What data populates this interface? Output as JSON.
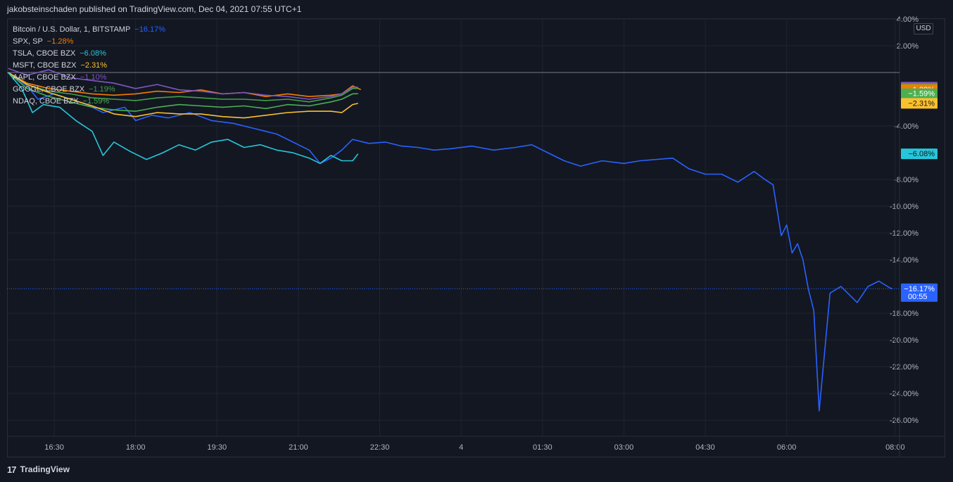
{
  "header": {
    "published_text": "jakobsteinschaden published on TradingView.com, Dec 04, 2021 07:55 UTC+1"
  },
  "footer": {
    "brand": "TradingView",
    "logo_icon": "tradingview-logo-icon"
  },
  "price_axis": {
    "currency": "USD"
  },
  "colors": {
    "background": "#131722",
    "grid": "#1f2431",
    "btc": "#2962ff",
    "spx": "#f57c00",
    "tsla": "#26c6da",
    "msft": "#fbc02d",
    "aapl": "#7e57c2",
    "googl": "#43a047",
    "ndaq": "#4caf50"
  },
  "chart_data": {
    "type": "line",
    "title": "Bitcoin / U.S. Dollar, 1, BITSTAMP",
    "y_unit": "%",
    "ylim": [
      -27.2,
      4.0
    ],
    "y_ticks": [
      "4.00%",
      "2.00%",
      "-4.00%",
      "-8.00%",
      "-10.00%",
      "-12.00%",
      "-14.00%",
      "-18.00%",
      "-20.00%",
      "-22.00%",
      "-24.00%",
      "-26.00%"
    ],
    "y_tick_values": [
      4,
      2,
      -4,
      -8,
      -10,
      -12,
      -14,
      -18,
      -20,
      -22,
      -24,
      -26
    ],
    "x_labels": [
      "16:30",
      "18:00",
      "19:30",
      "21:00",
      "22:30",
      "4",
      "01:30",
      "03:00",
      "04:30",
      "06:00",
      "08:00"
    ],
    "x_label_hours": [
      16.5,
      18,
      19.5,
      21,
      22.5,
      24,
      25.5,
      27,
      28.5,
      30,
      32
    ],
    "xlim_hours": [
      15.63,
      32.08
    ],
    "zero_line": 0,
    "legend": [
      {
        "key": "btc",
        "name": "Bitcoin / U.S. Dollar, 1, BITSTAMP",
        "value": "−16.17%"
      },
      {
        "key": "spx",
        "name": "SPX, SP",
        "value": "−1.28%"
      },
      {
        "key": "tsla",
        "name": "TSLA, CBOE BZX",
        "value": "−6.08%"
      },
      {
        "key": "msft",
        "name": "MSFT, CBOE BZX",
        "value": "−2.31%"
      },
      {
        "key": "aapl",
        "name": "AAPL, CBOE BZX",
        "value": "−1.10%"
      },
      {
        "key": "googl",
        "name": "GOOGL, CBOE BZX",
        "value": "−1.19%"
      },
      {
        "key": "ndaq",
        "name": "NDAQ, CBOE BZX",
        "value": "−1.59%"
      }
    ],
    "badges": [
      {
        "key": "aapl",
        "label": "−1.10%",
        "value": -1.1
      },
      {
        "key": "googl",
        "label": "−1.19%",
        "value": -1.19
      },
      {
        "key": "spx",
        "label": "−1.28%",
        "value": -1.28
      },
      {
        "key": "ndaq",
        "label": "−1.59%",
        "value": -1.59
      },
      {
        "key": "msft",
        "label": "−2.31%",
        "value": -2.31
      },
      {
        "key": "tsla",
        "label": "−6.08%",
        "value": -6.08
      },
      {
        "key": "btc",
        "label": "−16.17%",
        "value": -16.17,
        "countdown": "00:55"
      }
    ],
    "series": [
      {
        "key": "btc",
        "name": "Bitcoin / U.S. Dollar, 1, BITSTAMP",
        "x": [
          15.65,
          15.8,
          16.0,
          16.2,
          16.5,
          16.8,
          17.1,
          17.4,
          17.8,
          18.0,
          18.3,
          18.6,
          19.0,
          19.4,
          19.8,
          20.2,
          20.6,
          21.0,
          21.2,
          21.4,
          21.6,
          21.8,
          22.0,
          22.3,
          22.6,
          22.9,
          23.2,
          23.5,
          23.8,
          24.2,
          24.6,
          25.0,
          25.3,
          25.6,
          25.9,
          26.2,
          26.6,
          27.0,
          27.3,
          27.6,
          27.9,
          28.2,
          28.5,
          28.8,
          29.1,
          29.4,
          29.6,
          29.75,
          29.9,
          30.0,
          30.1,
          30.2,
          30.3,
          30.4,
          30.45,
          30.5,
          30.6,
          30.8,
          31.0,
          31.3,
          31.5,
          31.7,
          31.9,
          31.95
        ],
        "values": [
          0.0,
          -0.5,
          -1.0,
          -2.0,
          -1.6,
          -2.0,
          -2.4,
          -3.0,
          -2.6,
          -3.6,
          -3.2,
          -3.4,
          -3.0,
          -3.6,
          -3.8,
          -4.2,
          -4.6,
          -5.4,
          -5.8,
          -6.8,
          -6.4,
          -5.8,
          -5.0,
          -5.3,
          -5.2,
          -5.5,
          -5.6,
          -5.8,
          -5.7,
          -5.5,
          -5.8,
          -5.6,
          -5.4,
          -6.0,
          -6.6,
          -7.0,
          -6.6,
          -6.8,
          -6.6,
          -6.5,
          -6.4,
          -7.2,
          -7.6,
          -7.6,
          -8.2,
          -7.4,
          -8.0,
          -8.4,
          -12.2,
          -11.4,
          -13.5,
          -12.8,
          -14.0,
          -16.2,
          -17.0,
          -17.8,
          -25.3,
          -16.5,
          -16.0,
          -17.2,
          -16.0,
          -15.6,
          -16.1,
          -16.17
        ]
      },
      {
        "key": "spx",
        "name": "SPX, SP",
        "x": [
          15.65,
          16.0,
          16.4,
          16.8,
          17.2,
          17.6,
          18.0,
          18.4,
          18.8,
          19.2,
          19.6,
          20.0,
          20.4,
          20.8,
          21.2,
          21.6,
          21.8,
          22.0,
          22.15
        ],
        "values": [
          0.0,
          -0.8,
          -1.2,
          -1.4,
          -1.6,
          -1.7,
          -1.6,
          -1.4,
          -1.5,
          -1.3,
          -1.6,
          -1.5,
          -1.8,
          -1.6,
          -1.8,
          -1.7,
          -1.6,
          -1.0,
          -1.28
        ]
      },
      {
        "key": "aapl",
        "name": "AAPL, CBOE BZX",
        "x": [
          15.65,
          16.0,
          16.4,
          16.8,
          17.2,
          17.6,
          18.0,
          18.4,
          18.8,
          19.2,
          19.6,
          20.0,
          20.4,
          20.8,
          21.2,
          21.6,
          21.8,
          22.0,
          22.1
        ],
        "values": [
          0.3,
          -0.2,
          0.2,
          -0.4,
          -0.6,
          -0.8,
          -1.2,
          -0.9,
          -1.3,
          -1.4,
          -1.6,
          -1.5,
          -1.7,
          -1.8,
          -2.0,
          -1.8,
          -1.6,
          -1.1,
          -1.1
        ]
      },
      {
        "key": "googl",
        "name": "GOOGL, CBOE BZX",
        "x": [
          15.65,
          16.0,
          16.4,
          16.8,
          17.2,
          17.6,
          18.0,
          18.4,
          18.8,
          19.2,
          19.6,
          20.0,
          20.4,
          20.8,
          21.2,
          21.6,
          21.8,
          22.0,
          22.1
        ],
        "values": [
          0.0,
          -0.9,
          -1.4,
          -1.6,
          -1.9,
          -2.0,
          -2.1,
          -1.9,
          -1.8,
          -1.9,
          -2.0,
          -2.0,
          -2.1,
          -2.0,
          -2.2,
          -1.9,
          -1.7,
          -1.2,
          -1.19
        ]
      },
      {
        "key": "ndaq",
        "name": "NDAQ, CBOE BZX",
        "x": [
          15.65,
          16.0,
          16.4,
          16.8,
          17.2,
          17.6,
          18.0,
          18.4,
          18.8,
          19.2,
          19.6,
          20.0,
          20.4,
          20.8,
          21.2,
          21.6,
          21.8,
          22.0,
          22.1
        ],
        "values": [
          0.0,
          -1.2,
          -1.8,
          -2.2,
          -2.6,
          -2.8,
          -2.9,
          -2.6,
          -2.4,
          -2.5,
          -2.6,
          -2.5,
          -2.7,
          -2.4,
          -2.5,
          -2.2,
          -2.0,
          -1.6,
          -1.59
        ]
      },
      {
        "key": "msft",
        "name": "MSFT, CBOE BZX",
        "x": [
          15.65,
          16.0,
          16.4,
          16.8,
          17.2,
          17.6,
          18.0,
          18.4,
          18.8,
          19.2,
          19.6,
          20.0,
          20.4,
          20.8,
          21.2,
          21.6,
          21.8,
          22.0,
          22.1
        ],
        "values": [
          0.0,
          -0.9,
          -1.5,
          -2.0,
          -2.5,
          -3.1,
          -3.3,
          -3.0,
          -3.1,
          -3.1,
          -3.3,
          -3.4,
          -3.2,
          -3.0,
          -2.9,
          -2.9,
          -3.0,
          -2.4,
          -2.31
        ]
      },
      {
        "key": "tsla",
        "name": "TSLA, CBOE BZX",
        "x": [
          15.65,
          15.9,
          16.1,
          16.3,
          16.6,
          16.9,
          17.2,
          17.4,
          17.6,
          17.9,
          18.2,
          18.5,
          18.8,
          19.1,
          19.4,
          19.7,
          20.0,
          20.3,
          20.6,
          20.9,
          21.2,
          21.4,
          21.6,
          21.8,
          22.0,
          22.1
        ],
        "values": [
          0.0,
          -1.2,
          -3.0,
          -2.4,
          -2.6,
          -3.6,
          -4.4,
          -6.2,
          -5.2,
          -5.9,
          -6.5,
          -6.0,
          -5.4,
          -5.8,
          -5.2,
          -5.0,
          -5.6,
          -5.4,
          -5.8,
          -6.0,
          -6.4,
          -6.8,
          -6.2,
          -6.6,
          -6.6,
          -6.08
        ]
      }
    ]
  }
}
